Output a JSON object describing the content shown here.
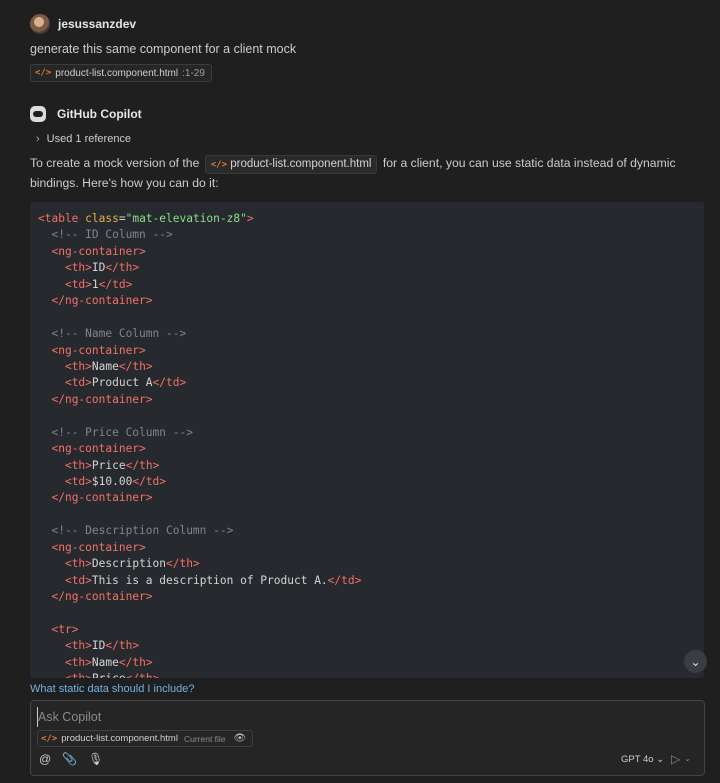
{
  "user": {
    "name": "jesussanzdev",
    "message": "generate this same component for a client mock"
  },
  "reference_chip": {
    "file": "product-list.component.html",
    "range": ":1-29"
  },
  "assistant": {
    "name": "GitHub Copilot",
    "used_references": "Used 1 reference",
    "intro_before": "To create a mock version of the",
    "intro_file": "product-list.component.html",
    "intro_after": "for a client, you can use static data instead of dynamic bindings. Here's how you can do it:"
  },
  "code_lines": [
    [
      [
        "tag",
        "<table"
      ],
      [
        "txt",
        " "
      ],
      [
        "attr",
        "class"
      ],
      [
        "txt",
        "="
      ],
      [
        "str",
        "\"mat-elevation-z8\""
      ],
      [
        "tag",
        ">"
      ]
    ],
    [
      [
        "txt",
        "  "
      ],
      [
        "cmt",
        "<!-- ID Column -->"
      ]
    ],
    [
      [
        "txt",
        "  "
      ],
      [
        "tag",
        "<ng-container"
      ],
      [
        "tag",
        ">"
      ]
    ],
    [
      [
        "txt",
        "    "
      ],
      [
        "tag",
        "<th"
      ],
      [
        "tag",
        ">"
      ],
      [
        "txt",
        "ID"
      ],
      [
        "tag",
        "</th"
      ],
      [
        "tag",
        ">"
      ]
    ],
    [
      [
        "txt",
        "    "
      ],
      [
        "tag",
        "<td"
      ],
      [
        "tag",
        ">"
      ],
      [
        "txt",
        "1"
      ],
      [
        "tag",
        "</td"
      ],
      [
        "tag",
        ">"
      ]
    ],
    [
      [
        "txt",
        "  "
      ],
      [
        "tag",
        "</ng-container"
      ],
      [
        "tag",
        ">"
      ]
    ],
    [],
    [
      [
        "txt",
        "  "
      ],
      [
        "cmt",
        "<!-- Name Column -->"
      ]
    ],
    [
      [
        "txt",
        "  "
      ],
      [
        "tag",
        "<ng-container"
      ],
      [
        "tag",
        ">"
      ]
    ],
    [
      [
        "txt",
        "    "
      ],
      [
        "tag",
        "<th"
      ],
      [
        "tag",
        ">"
      ],
      [
        "txt",
        "Name"
      ],
      [
        "tag",
        "</th"
      ],
      [
        "tag",
        ">"
      ]
    ],
    [
      [
        "txt",
        "    "
      ],
      [
        "tag",
        "<td"
      ],
      [
        "tag",
        ">"
      ],
      [
        "txt",
        "Product A"
      ],
      [
        "tag",
        "</td"
      ],
      [
        "tag",
        ">"
      ]
    ],
    [
      [
        "txt",
        "  "
      ],
      [
        "tag",
        "</ng-container"
      ],
      [
        "tag",
        ">"
      ]
    ],
    [],
    [
      [
        "txt",
        "  "
      ],
      [
        "cmt",
        "<!-- Price Column -->"
      ]
    ],
    [
      [
        "txt",
        "  "
      ],
      [
        "tag",
        "<ng-container"
      ],
      [
        "tag",
        ">"
      ]
    ],
    [
      [
        "txt",
        "    "
      ],
      [
        "tag",
        "<th"
      ],
      [
        "tag",
        ">"
      ],
      [
        "txt",
        "Price"
      ],
      [
        "tag",
        "</th"
      ],
      [
        "tag",
        ">"
      ]
    ],
    [
      [
        "txt",
        "    "
      ],
      [
        "tag",
        "<td"
      ],
      [
        "tag",
        ">"
      ],
      [
        "txt",
        "$10.00"
      ],
      [
        "tag",
        "</td"
      ],
      [
        "tag",
        ">"
      ]
    ],
    [
      [
        "txt",
        "  "
      ],
      [
        "tag",
        "</ng-container"
      ],
      [
        "tag",
        ">"
      ]
    ],
    [],
    [
      [
        "txt",
        "  "
      ],
      [
        "cmt",
        "<!-- Description Column -->"
      ]
    ],
    [
      [
        "txt",
        "  "
      ],
      [
        "tag",
        "<ng-container"
      ],
      [
        "tag",
        ">"
      ]
    ],
    [
      [
        "txt",
        "    "
      ],
      [
        "tag",
        "<th"
      ],
      [
        "tag",
        ">"
      ],
      [
        "txt",
        "Description"
      ],
      [
        "tag",
        "</th"
      ],
      [
        "tag",
        ">"
      ]
    ],
    [
      [
        "txt",
        "    "
      ],
      [
        "tag",
        "<td"
      ],
      [
        "tag",
        ">"
      ],
      [
        "txt",
        "This is a description of Product A."
      ],
      [
        "tag",
        "</td"
      ],
      [
        "tag",
        ">"
      ]
    ],
    [
      [
        "txt",
        "  "
      ],
      [
        "tag",
        "</ng-container"
      ],
      [
        "tag",
        ">"
      ]
    ],
    [],
    [
      [
        "txt",
        "  "
      ],
      [
        "tag",
        "<tr"
      ],
      [
        "tag",
        ">"
      ]
    ],
    [
      [
        "txt",
        "    "
      ],
      [
        "tag",
        "<th"
      ],
      [
        "tag",
        ">"
      ],
      [
        "txt",
        "ID"
      ],
      [
        "tag",
        "</th"
      ],
      [
        "tag",
        ">"
      ]
    ],
    [
      [
        "txt",
        "    "
      ],
      [
        "tag",
        "<th"
      ],
      [
        "tag",
        ">"
      ],
      [
        "txt",
        "Name"
      ],
      [
        "tag",
        "</th"
      ],
      [
        "tag",
        ">"
      ]
    ],
    [
      [
        "txt",
        "    "
      ],
      [
        "tag",
        "<th"
      ],
      [
        "tag",
        ">"
      ],
      [
        "txt",
        "Price"
      ],
      [
        "tag",
        "</th"
      ],
      [
        "tag",
        ">"
      ]
    ]
  ],
  "suggestion": "What static data should I include?",
  "input": {
    "placeholder": "Ask Copilot",
    "file_chip": "product-list.component.html",
    "file_chip_status": "Current file",
    "model": "GPT 4o"
  },
  "icons": {
    "code_file": "</>",
    "chevron_right": "›",
    "scroll_down": "⌄",
    "eye": "👁",
    "at": "@",
    "paperclip": "📎",
    "microphone": "🎙",
    "send": "▷",
    "dropdown_caret": "⌄"
  }
}
